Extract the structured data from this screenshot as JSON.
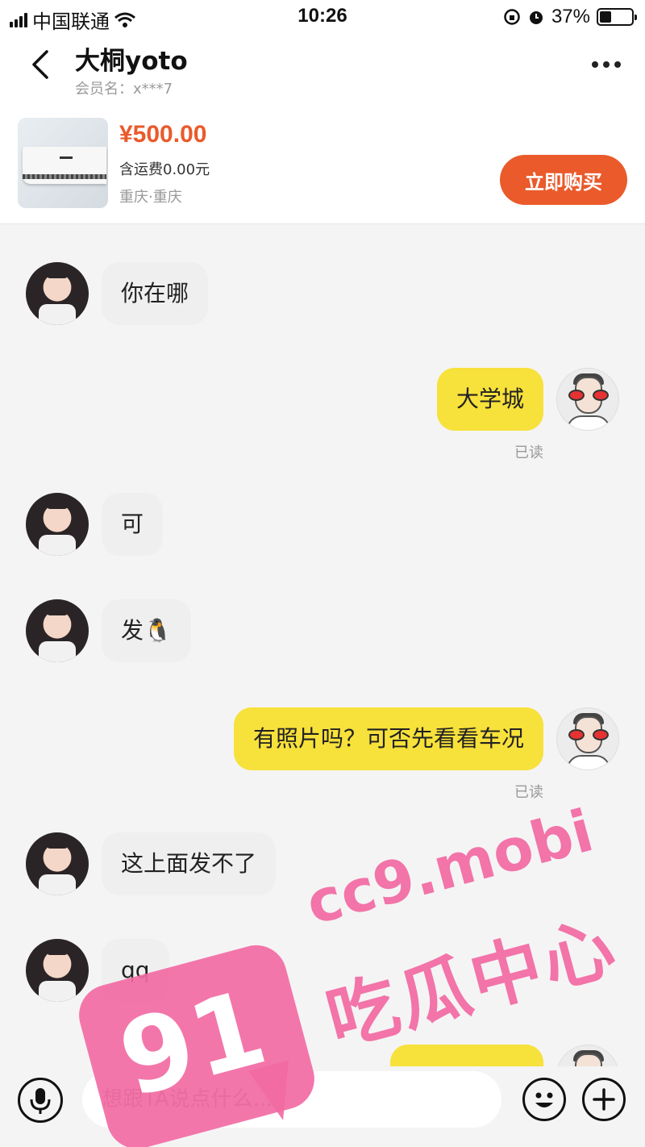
{
  "status_bar": {
    "carrier": "中国联通",
    "time": "10:26",
    "battery": "37%"
  },
  "header": {
    "contact_name": "大桐yoto",
    "member_label": "会员名：x***7"
  },
  "product": {
    "price": "¥500.00",
    "shipping": "含运费0.00元",
    "location": "重庆·重庆",
    "buy_label": "立即购买"
  },
  "messages": [
    {
      "side": "in",
      "text": "你在哪"
    },
    {
      "side": "out",
      "text": "大学城",
      "status": "已读"
    },
    {
      "side": "in",
      "text": "可"
    },
    {
      "side": "in",
      "text": "发🐧"
    },
    {
      "side": "out",
      "text": "有照片吗？可否先看看车况",
      "status": "已读"
    },
    {
      "side": "in",
      "text": "这上面发不了"
    },
    {
      "side": "in",
      "text": "qq"
    }
  ],
  "input": {
    "placeholder": "想跟TA说点什么..."
  },
  "watermark": {
    "badge": "91",
    "domain": "cc9.mobi",
    "label": "吃瓜中心"
  }
}
